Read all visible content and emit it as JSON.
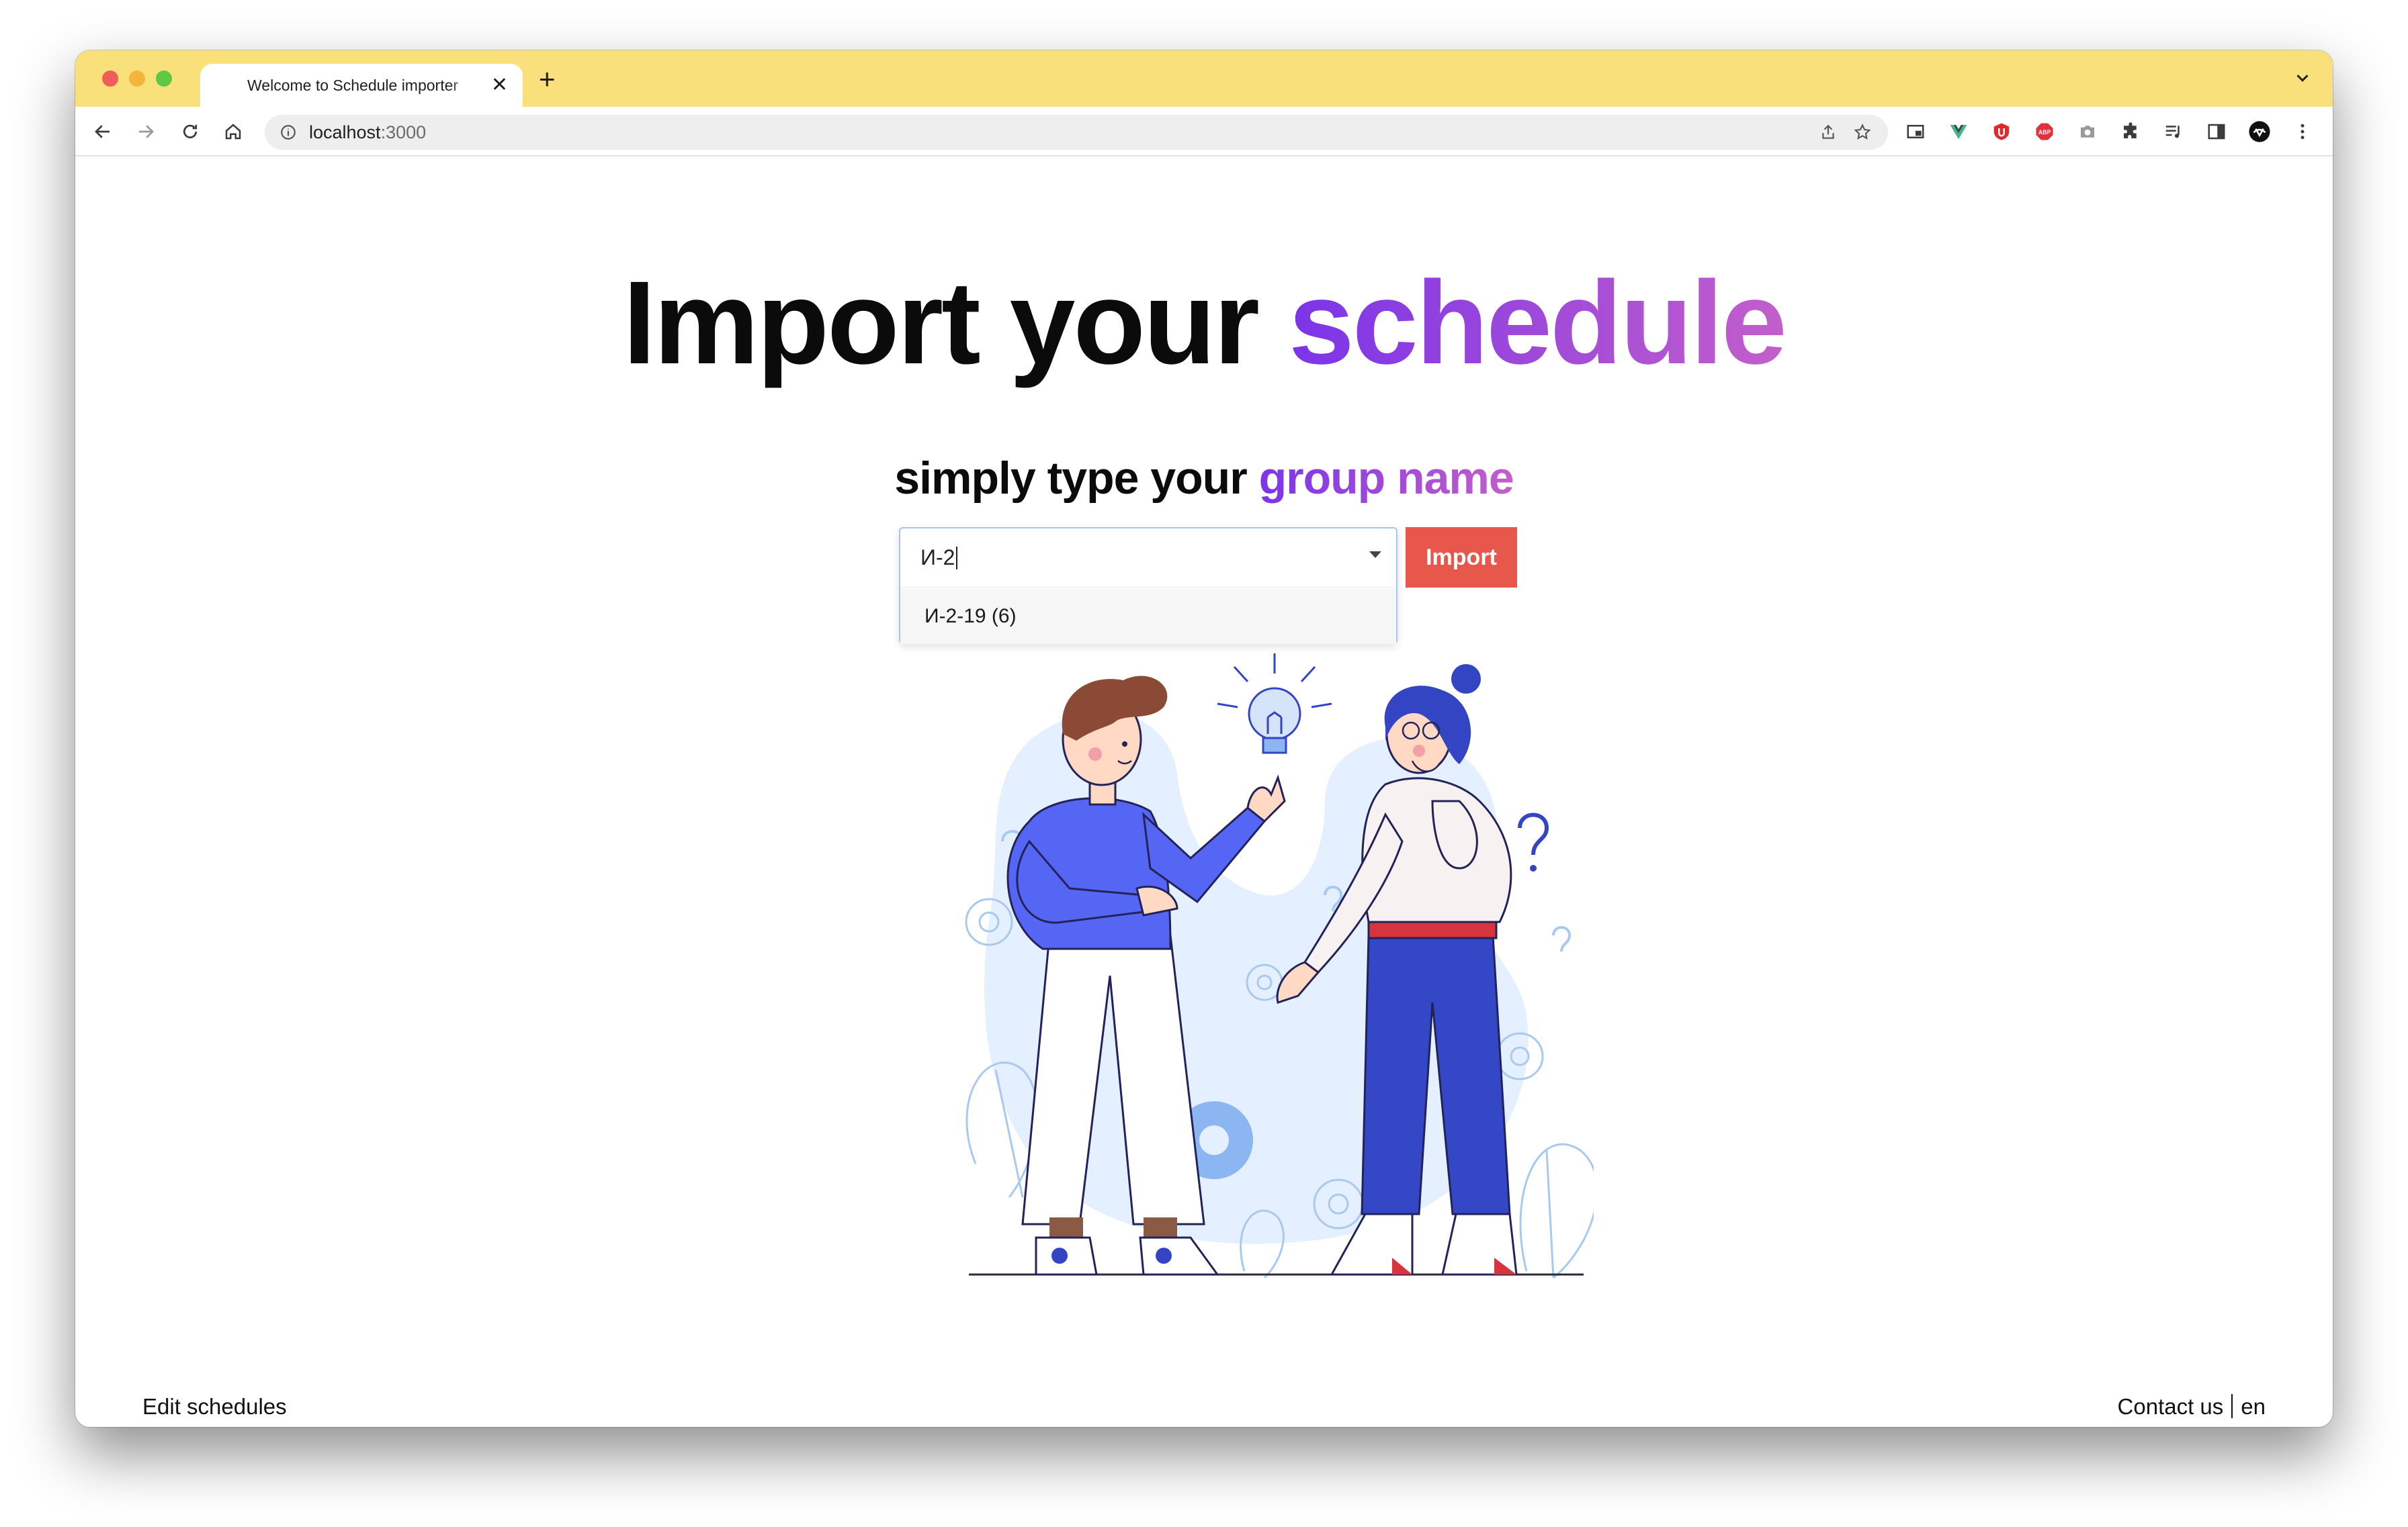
{
  "browser": {
    "tab_title": "Welcome to Schedule importer",
    "url_host": "localhost",
    "url_port": ":3000"
  },
  "hero": {
    "title_plain": "Import your ",
    "title_accent": "schedule",
    "subtitle_plain": "simply type your ",
    "subtitle_accent": "group name"
  },
  "search": {
    "value": "И-2",
    "options": [
      "И-2-19 (6)"
    ],
    "button_label": "Import"
  },
  "footer": {
    "edit_link": "Edit schedules",
    "contact_link": "Contact us",
    "language": "en"
  },
  "colors": {
    "tab_strip": "#f9e07b",
    "accent_gradient_start": "#7b34e8",
    "accent_gradient_end": "#c35fcb",
    "import_button": "#e8574b"
  }
}
